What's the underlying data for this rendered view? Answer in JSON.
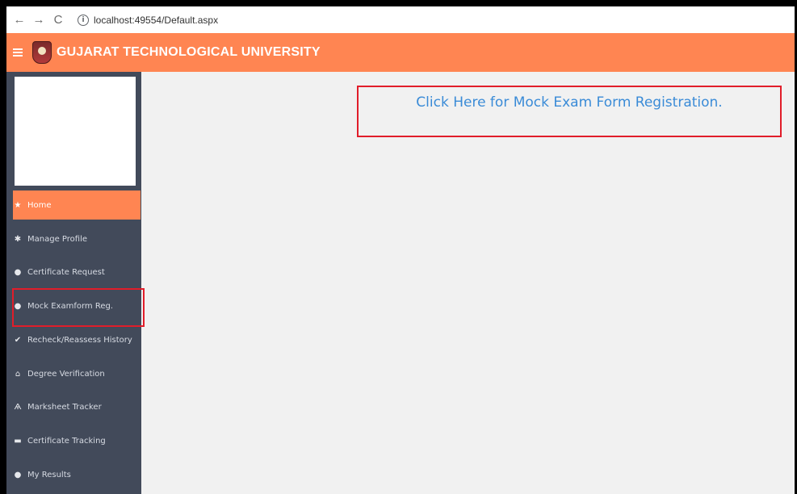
{
  "browser": {
    "back_icon": "←",
    "forward_icon": "→",
    "reload_icon": "C",
    "info_icon": "i",
    "url": "localhost:49554/Default.aspx"
  },
  "header": {
    "brand_title": "GUJARAT TECHNOLOGICAL UNIVERSITY",
    "accent_color": "#ff8552"
  },
  "sidebar": {
    "items": [
      {
        "label": "Home",
        "icon": "★"
      },
      {
        "label": "Manage Profile",
        "icon": "✱"
      },
      {
        "label": "Certificate Request",
        "icon": "●"
      },
      {
        "label": "Mock Examform Reg.",
        "icon": "●"
      },
      {
        "label": "Recheck/Reassess History",
        "icon": "✔"
      },
      {
        "label": "Degree Verification",
        "icon": "⌂"
      },
      {
        "label": "Marksheet Tracker",
        "icon": "Ѧ"
      },
      {
        "label": "Certificate Tracking",
        "icon": "▬"
      },
      {
        "label": "My Results",
        "icon": "●"
      }
    ]
  },
  "main": {
    "mock_link_text": "Click Here for Mock Exam Form Registration."
  }
}
